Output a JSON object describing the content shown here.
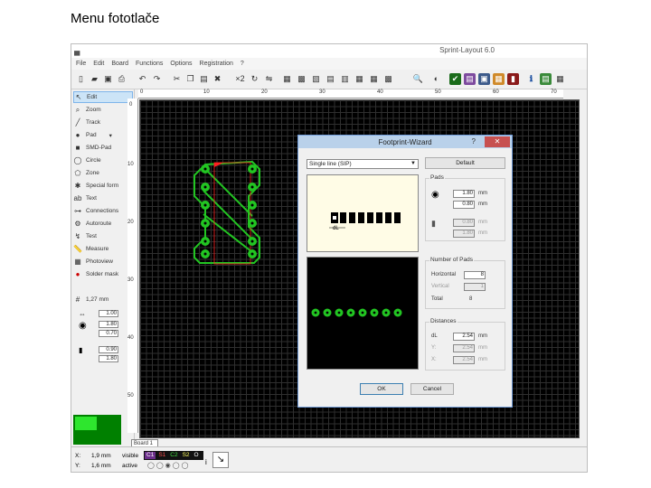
{
  "slide_title": "Menu fototlače",
  "app": {
    "title": "Sprint-Layout 6.0",
    "menu": [
      "File",
      "Edit",
      "Board",
      "Functions",
      "Options",
      "Registration",
      "?"
    ],
    "tools": [
      {
        "label": "Edit",
        "icon": "cursor-icon"
      },
      {
        "label": "Zoom",
        "icon": "zoom-icon"
      },
      {
        "label": "Track",
        "icon": "track-icon"
      },
      {
        "label": "Pad",
        "icon": "pad-icon"
      },
      {
        "label": "SMD-Pad",
        "icon": "smd-pad-icon"
      },
      {
        "label": "Circle",
        "icon": "circle-icon"
      },
      {
        "label": "Zone",
        "icon": "zone-icon"
      },
      {
        "label": "Special form",
        "icon": "special-form-icon"
      },
      {
        "label": "Text",
        "icon": "text-icon"
      },
      {
        "label": "Connections",
        "icon": "connections-icon"
      },
      {
        "label": "Autoroute",
        "icon": "autoroute-icon"
      },
      {
        "label": "Test",
        "icon": "test-icon"
      },
      {
        "label": "Measure",
        "icon": "measure-icon"
      },
      {
        "label": "Photoview",
        "icon": "photoview-icon"
      },
      {
        "label": "Solder mask",
        "icon": "solder-mask-icon"
      }
    ],
    "grid_label": "1,27 mm",
    "track_width": "1.00",
    "pad_outer": "1.80",
    "pad_inner": "0.70",
    "smd_w": "0.90",
    "smd_h": "1.80",
    "ruler_top": [
      "0",
      "10",
      "20",
      "30",
      "40",
      "50",
      "60",
      "70"
    ],
    "ruler_left": [
      "0",
      "10",
      "20",
      "30",
      "40",
      "50"
    ],
    "tab": "Board 1",
    "status": {
      "x_label": "X:",
      "x_value": "1,9 mm",
      "y_label": "Y:",
      "y_value": "1,6 mm",
      "visible_label": "visible",
      "active_label": "active",
      "layers": [
        "C1",
        "S1",
        "C2",
        "S2",
        "O"
      ]
    }
  },
  "dialog": {
    "title": "Footprint-Wizard",
    "help": "?",
    "close": "✕",
    "type_selected": "Single line (SIP)",
    "default_button": "Default",
    "pads_group": "Pads",
    "pad_outer": "1.80",
    "pad_inner": "0.80",
    "pad_outer_dim": "0.80",
    "pad_inner_dim": "1.80",
    "unit": "mm",
    "number_group": "Number of Pads",
    "horizontal_label": "Horizontal",
    "horizontal_value": "8",
    "vertical_label": "Vertical",
    "vertical_value": "1",
    "total_label": "Total",
    "total_value": "8",
    "distance_group": "Distances",
    "dx_label": "dL",
    "dx_value": "2.54",
    "y_label": "Y:",
    "y_value": "2.54",
    "x_label": "X:",
    "x_value": "2.54",
    "preview_label": "dL",
    "ok_button": "OK",
    "cancel_button": "Cancel",
    "pad_count": 8
  },
  "colors": {
    "canvas": "#000000",
    "track": "#22c522",
    "selection": "#ff2020",
    "dialog_title": "#b9d1ea",
    "close": "#c75050"
  }
}
